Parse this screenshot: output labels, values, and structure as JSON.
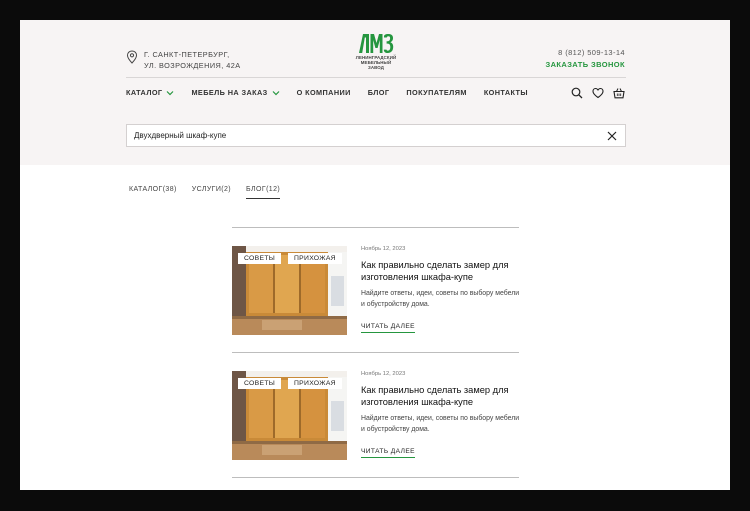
{
  "header": {
    "address": [
      "Г. САНКТ-ПЕТЕРБУРГ,",
      "УЛ. ВОЗРОЖДЕНИЯ, 42А"
    ],
    "logo": {
      "sub_line1": "ЛЕНИНГРАДСКИЙ",
      "sub_line2": "МЕБЕЛЬНЫЙ ЗАВОД"
    },
    "phone": "8 (812) 509-13-14",
    "call_label": "ЗАКАЗАТЬ ЗВОНОК"
  },
  "nav": {
    "items": [
      {
        "label": "КАТАЛОГ",
        "dropdown": true
      },
      {
        "label": "МЕБЕЛЬ НА ЗАКАЗ",
        "dropdown": true
      },
      {
        "label": "О КОМПАНИИ",
        "dropdown": false
      },
      {
        "label": "БЛОГ",
        "dropdown": false
      },
      {
        "label": "ПОКУПАТЕЛЯМ",
        "dropdown": false
      },
      {
        "label": "КОНТАКТЫ",
        "dropdown": false
      }
    ],
    "icons": [
      "search-icon",
      "heart-icon",
      "basket-icon"
    ]
  },
  "search": {
    "value": "Двухдверный шкаф-купе",
    "placeholder": ""
  },
  "tabs": [
    {
      "label": "КАТАЛОГ(38)",
      "active": false
    },
    {
      "label": "УСЛУГИ(2)",
      "active": false
    },
    {
      "label": "БЛОГ(12)",
      "active": true
    }
  ],
  "posts": [
    {
      "tags": [
        "СОВЕТЫ",
        "ПРИХОЖАЯ"
      ],
      "date": "Ноябрь 12, 2023",
      "title": "Как правильно сделать замер для изготовления шкафа-купе",
      "desc": "Найдите ответы, идеи, советы по выбору мебели и обустройству дома.",
      "more": "ЧИТАТЬ ДАЛЕЕ"
    },
    {
      "tags": [
        "СОВЕТЫ",
        "ПРИХОЖАЯ"
      ],
      "date": "Ноябрь 12, 2023",
      "title": "Как правильно сделать замер для изготовления шкафа-купе",
      "desc": "Найдите ответы, идеи, советы по выбору мебели и обустройству дома.",
      "more": "ЧИТАТЬ ДАЛЕЕ"
    }
  ],
  "colors": {
    "accent": "#25963f",
    "hero_bg": "#f7f4f4",
    "text": "#222222"
  }
}
